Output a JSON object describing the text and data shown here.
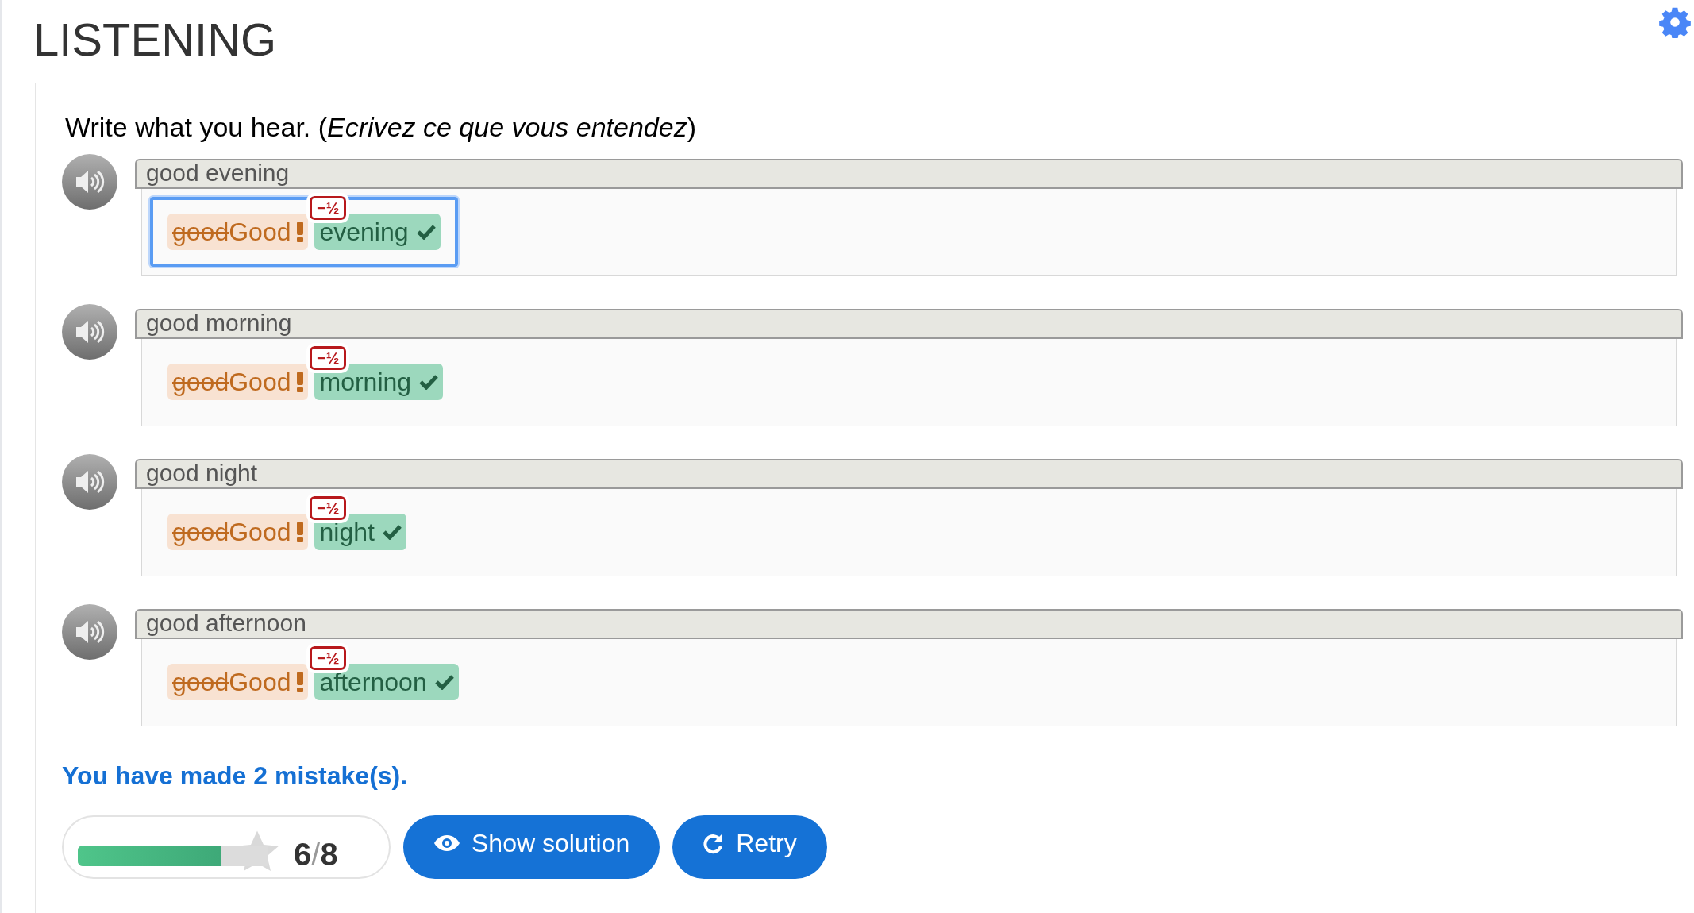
{
  "title": "LISTENING",
  "instruction": "Write what you hear. (*Ecrivez ce que vous entendez*)",
  "items": [
    {
      "heard": "good evening",
      "focused": true,
      "tokens": [
        {
          "kind": "wrong",
          "struck": "good",
          "correction": "Good",
          "penalty": "−½"
        },
        {
          "kind": "correct",
          "text": "evening"
        }
      ]
    },
    {
      "heard": "good morning",
      "focused": false,
      "tokens": [
        {
          "kind": "wrong",
          "struck": "good",
          "correction": "Good",
          "penalty": "−½"
        },
        {
          "kind": "correct",
          "text": "morning"
        }
      ]
    },
    {
      "heard": "good night",
      "focused": false,
      "tokens": [
        {
          "kind": "wrong",
          "struck": "good",
          "correction": "Good",
          "penalty": "−½"
        },
        {
          "kind": "correct",
          "text": "night"
        }
      ]
    },
    {
      "heard": "good afternoon",
      "focused": false,
      "tokens": [
        {
          "kind": "wrong",
          "struck": "good",
          "correction": "Good",
          "penalty": "−½"
        },
        {
          "kind": "correct",
          "text": "afternoon"
        }
      ]
    }
  ],
  "result": "You have made 2 mistake(s).",
  "score": {
    "level": 0.75,
    "value": "6",
    "separator": "/",
    "total": "8"
  },
  "buttons": [
    {
      "kind": "solution",
      "label": "Show solution"
    },
    {
      "kind": "retry",
      "label": "Retry"
    }
  ]
}
